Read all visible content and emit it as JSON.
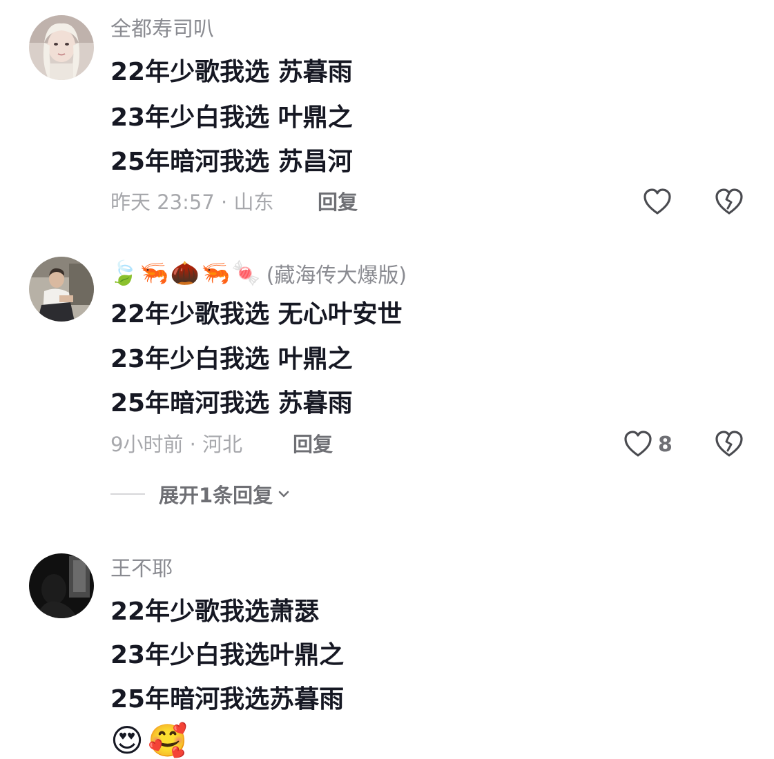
{
  "comments": [
    {
      "username": "全都寿司叭",
      "lines": [
        "22年少歌我选 苏暮雨",
        "23年少白我选 叶鼎之",
        "25年暗河我选 苏昌河"
      ],
      "meta": "昨天 23:57 · 山东",
      "reply_label": "回复",
      "like_count": ""
    },
    {
      "username_emojis": [
        "🍃",
        "🦐",
        "🌰",
        "🦐",
        "🍬"
      ],
      "username_suffix": "(藏海传大爆版)",
      "lines": [
        "22年少歌我选 无心叶安世",
        "23年少白我选 叶鼎之",
        "25年暗河我选 苏暮雨"
      ],
      "meta": "9小时前 · 河北",
      "reply_label": "回复",
      "like_count": "8",
      "expand_label": "展开1条回复"
    },
    {
      "username": "王不耶",
      "lines": [
        "22年少歌我选萧瑟",
        "23年少白我选叶鼎之",
        "25年暗河我选苏暮雨"
      ],
      "emojis": [
        "😍",
        "🥰"
      ]
    }
  ],
  "icons": {
    "like": "heart-outline-icon",
    "dislike": "broken-heart-icon",
    "expand": "chevron-down-icon"
  },
  "colors": {
    "text_primary": "#161823",
    "text_secondary": "#8a8b91",
    "icon": "#4a4b50"
  }
}
